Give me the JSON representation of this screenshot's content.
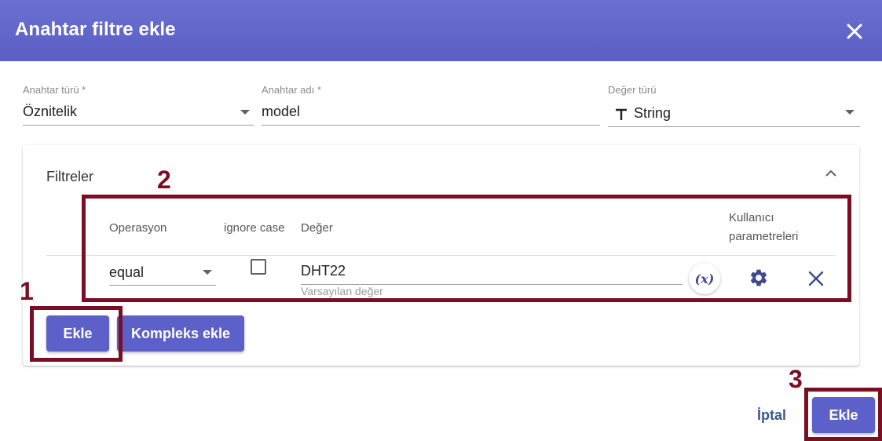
{
  "dialog": {
    "title": "Anahtar filtre ekle",
    "close_icon": "close-icon"
  },
  "key_type": {
    "label": "Anahtar türü *",
    "value": "Öznitelik"
  },
  "key_name": {
    "label": "Anahtar adı *",
    "value": "model"
  },
  "value_type": {
    "label": "Değer türü",
    "value": "String",
    "icon": "text-type-icon"
  },
  "filters": {
    "title": "Filtreler",
    "columns": {
      "operation": "Operasyon",
      "ignore_case": "ignore case",
      "value": "Değer",
      "user_params_line1": "Kullanıcı",
      "user_params_line2": "parametreleri"
    },
    "rows": [
      {
        "operation": "equal",
        "ignore_case": false,
        "value": "DHT22",
        "hint": "Varsayılan değer",
        "fx_label": "(x)"
      }
    ],
    "add_button": "Ekle",
    "add_complex_button": "Kompleks ekle"
  },
  "footer": {
    "cancel": "İptal",
    "add": "Ekle"
  },
  "annotations": {
    "one": "1",
    "two": "2",
    "three": "3",
    "color": "#7a0f24"
  },
  "colors": {
    "header": "#5a5ec6",
    "primary": "#5c60c8"
  }
}
